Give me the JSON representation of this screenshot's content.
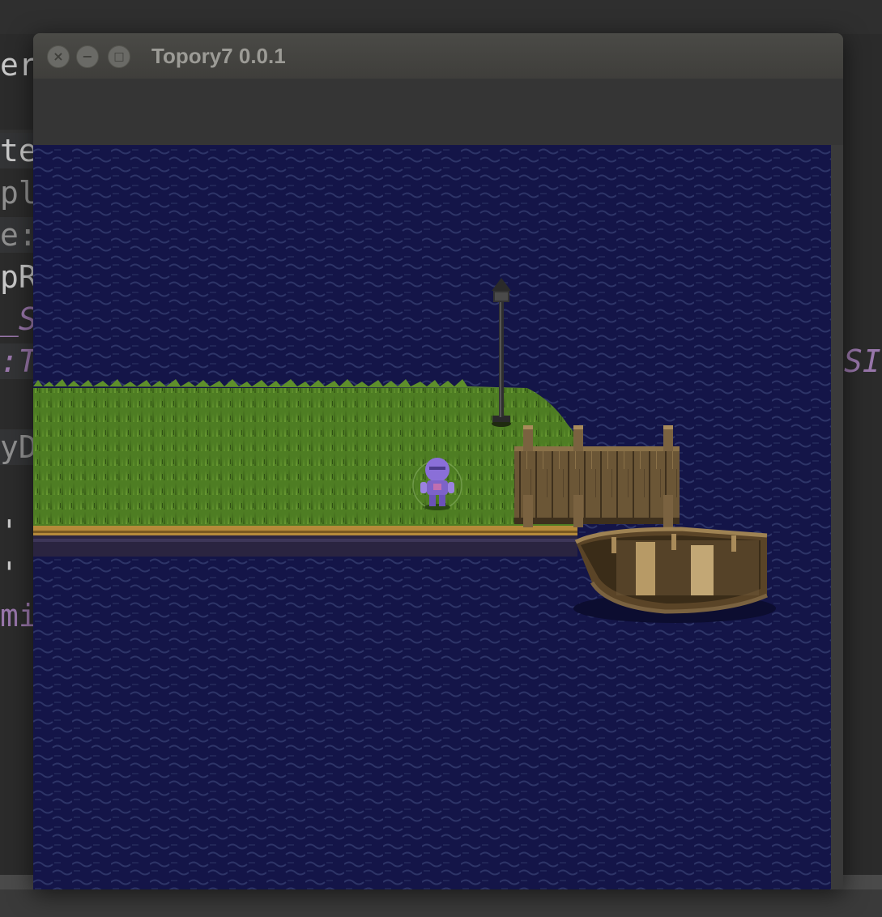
{
  "background_editor": {
    "lines": [
      {
        "text": "er",
        "style": "normal"
      },
      {
        "text": "te",
        "style": "normal"
      },
      {
        "text": "pl",
        "style": "dim"
      },
      {
        "text": "e:",
        "style": "dim"
      },
      {
        "text": "pR",
        "style": "normal"
      },
      {
        "text": "_S",
        "style": "purple"
      },
      {
        "text": ":T",
        "style": "purple"
      },
      {
        "text": "yD",
        "style": "dim"
      },
      {
        "text": "' /",
        "style": "normal"
      },
      {
        "text": "' /",
        "style": "normal"
      },
      {
        "text": "mi",
        "style": "purple2"
      }
    ],
    "right_fragment": "SI"
  },
  "window": {
    "title": "Topory7 0.0.1",
    "buttons": {
      "close": "×",
      "minimize": "−",
      "maximize": "□"
    }
  },
  "game_scene": {
    "colors": {
      "water": "#141548",
      "water_wave": "#2e3568",
      "grass": "#4e7d23",
      "grass_dark": "#3a6018",
      "shore": "#b58a3a",
      "wood": "#6b5636",
      "wood_dark": "#3e301d",
      "player": "#8a6fd8"
    },
    "objects": [
      "grass-island-icon",
      "lamp-post-icon",
      "wooden-dock-icon",
      "rowboat-icon",
      "player-character-icon"
    ]
  }
}
